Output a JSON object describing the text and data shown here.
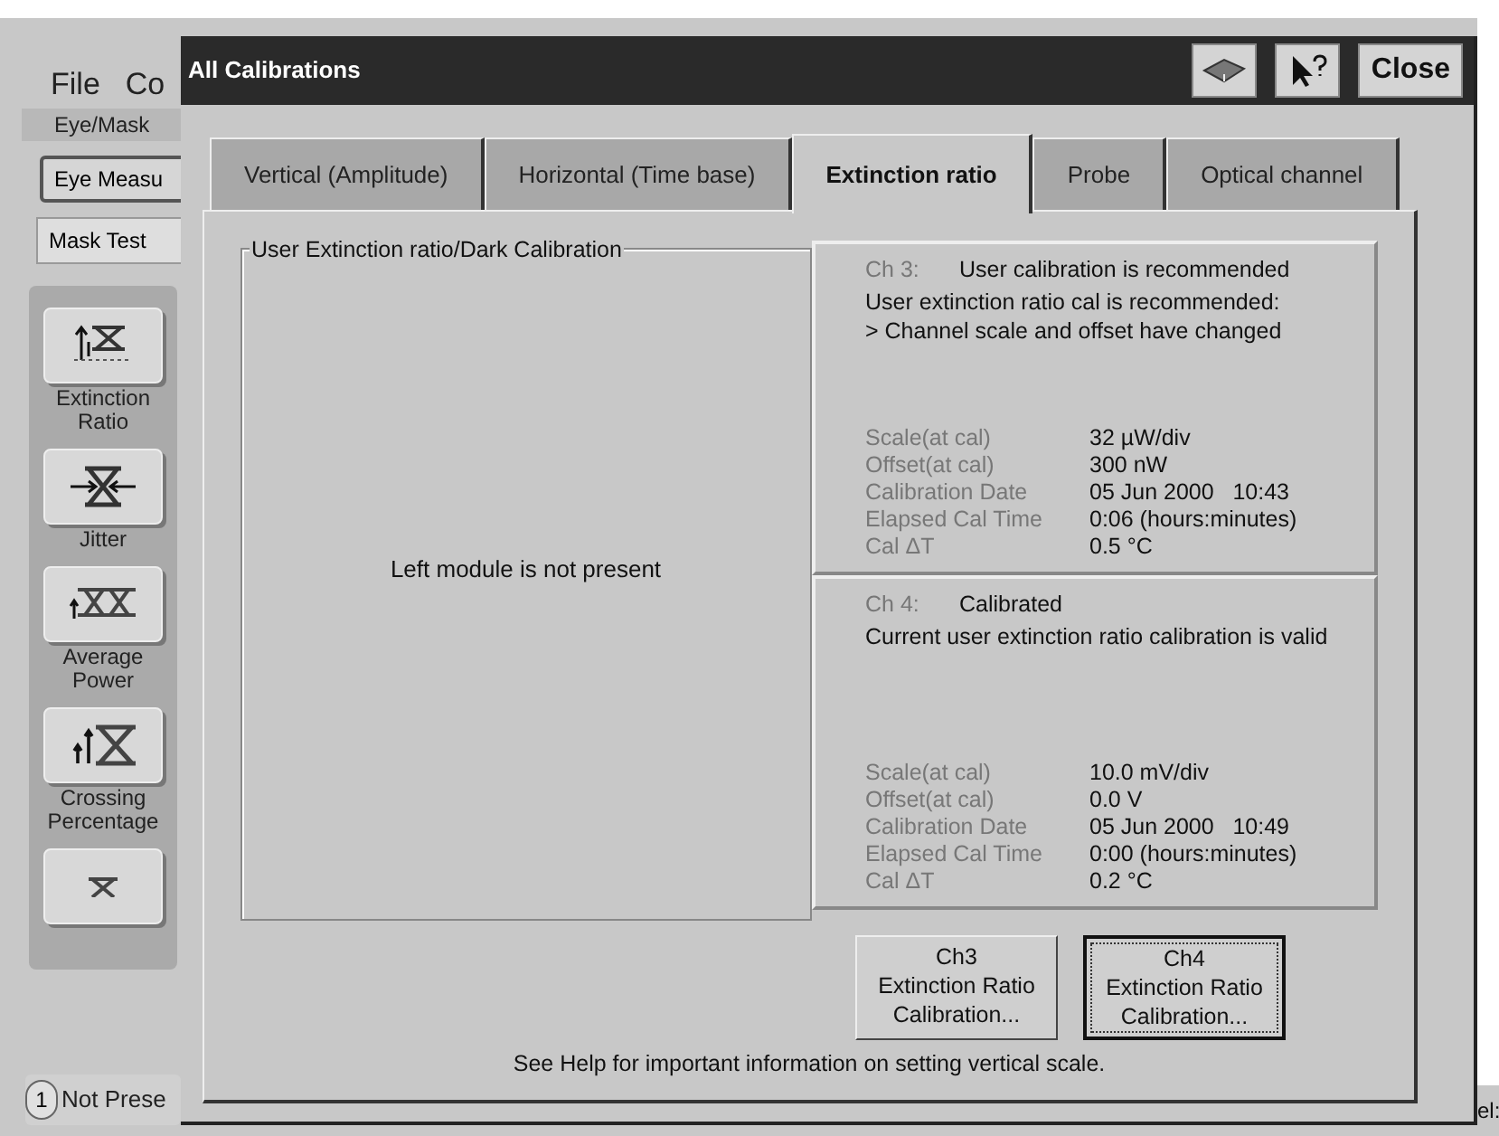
{
  "background_app": {
    "menu": [
      "File",
      "Co"
    ],
    "mode_label": "Eye/Mask",
    "mode_buttons": [
      {
        "label": "Eye Measu",
        "selected": true
      },
      {
        "label": "Mask Test",
        "selected": false
      }
    ],
    "measurements": [
      {
        "kind": "extinction",
        "label": "Extinction Ratio"
      },
      {
        "kind": "jitter",
        "label": "Jitter"
      },
      {
        "kind": "power",
        "label": "Average Power"
      },
      {
        "kind": "crossing",
        "label": "Crossing Percentage"
      },
      {
        "kind": "partial"
      }
    ],
    "channel_badge": "1",
    "channel_status": "Not Prese",
    "right_label": "el:"
  },
  "dialog": {
    "title": "All Calibrations",
    "close_label": "Close",
    "tabs": [
      {
        "label": "Vertical (Amplitude)",
        "selected": false
      },
      {
        "label": "Horizontal (Time base)",
        "selected": false
      },
      {
        "label": "Extinction ratio",
        "selected": true
      },
      {
        "label": "Probe",
        "selected": false
      },
      {
        "label": "Optical channel",
        "selected": false
      }
    ],
    "group_title": "User Extinction ratio/Dark Calibration",
    "left_message": "Left module is not present",
    "channels": [
      {
        "name": "Ch 3:",
        "status": "User calibration is recommended",
        "messages": [
          "User extinction ratio cal is recommended:",
          "> Channel scale and offset have changed"
        ],
        "fields": [
          {
            "label": "Scale(at cal)",
            "value": "32 µW/div"
          },
          {
            "label": "Offset(at cal)",
            "value": "300 nW"
          },
          {
            "label": "Calibration Date",
            "value": "05 Jun 2000   10:43"
          },
          {
            "label": "Elapsed Cal Time",
            "value": "0:06 (hours:minutes)"
          },
          {
            "label": "Cal ΔT",
            "value": "0.5 °C"
          }
        ]
      },
      {
        "name": "Ch 4:",
        "status": "Calibrated",
        "messages": [
          "Current user extinction ratio calibration is valid"
        ],
        "fields": [
          {
            "label": "Scale(at cal)",
            "value": "10.0 mV/div"
          },
          {
            "label": "Offset(at cal)",
            "value": "0.0 V"
          },
          {
            "label": "Calibration Date",
            "value": "05 Jun 2000   10:49"
          },
          {
            "label": "Elapsed Cal Time",
            "value": "0:00 (hours:minutes)"
          },
          {
            "label": "Cal ΔT",
            "value": "0.2 °C"
          }
        ]
      }
    ],
    "buttons": [
      {
        "lines": [
          "Ch3",
          "Extinction Ratio",
          "Calibration..."
        ],
        "focused": false
      },
      {
        "lines": [
          "Ch4",
          "Extinction Ratio",
          "Calibration..."
        ],
        "focused": true
      }
    ],
    "footer": "See Help for important information on setting vertical scale."
  }
}
